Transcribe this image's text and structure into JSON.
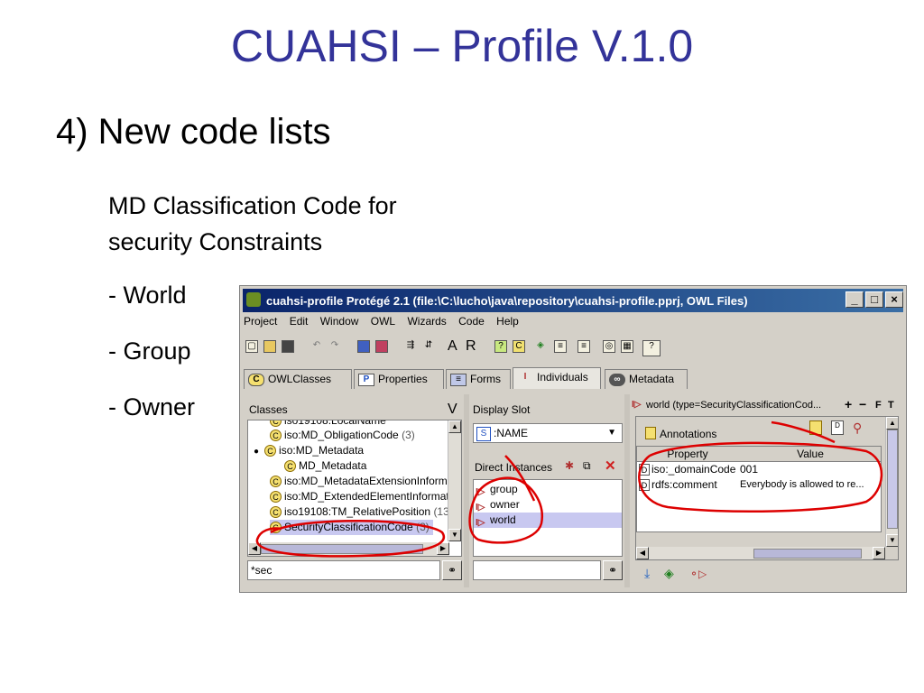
{
  "slide": {
    "title": "CUAHSI – Profile V.1.0",
    "subtitle": "4) New code lists",
    "description_line1": "MD Classification Code for",
    "description_line2": "security Constraints",
    "bullets": [
      "- World",
      "- Group",
      "- Owner"
    ]
  },
  "window": {
    "title": "cuahsi-profile  Protégé 2.1     (file:\\C:\\lucho\\java\\repository\\cuahsi-profile.pprj, OWL Files)",
    "controls": {
      "minimize": "_",
      "maximize": "□",
      "close": "×"
    },
    "menu": [
      "Project",
      "Edit",
      "Window",
      "OWL",
      "Wizards",
      "Code",
      "Help"
    ],
    "toolbar_text": [
      "A",
      "R"
    ],
    "tabs": [
      {
        "label": "OWLClasses",
        "icon": "C"
      },
      {
        "label": "Properties",
        "icon": "P"
      },
      {
        "label": "Forms",
        "icon": "≡"
      },
      {
        "label": "Individuals",
        "icon": "I"
      },
      {
        "label": "Metadata",
        "icon": "∞"
      }
    ],
    "selected_tab": "Individuals"
  },
  "classes_panel": {
    "header": "Classes",
    "header_right": "V",
    "items": [
      {
        "label": "iso19108:LocalName",
        "count": ""
      },
      {
        "label": "iso:MD_ObligationCode",
        "count": "(3)"
      },
      {
        "label": "iso:MD_Metadata",
        "count": ""
      },
      {
        "label": "MD_Metadata",
        "count": ""
      },
      {
        "label": "iso:MD_MetadataExtensionInformat",
        "count": ""
      },
      {
        "label": "iso:MD_ExtendedElementInformatic",
        "count": ""
      },
      {
        "label": "iso19108:TM_RelativePosition",
        "count": "(13)"
      },
      {
        "label": "SecurityClassificationCode",
        "count": "(3)"
      }
    ],
    "search_value": "*sec"
  },
  "instances_panel": {
    "display_slot_label": "Display Slot",
    "slot_value": ":NAME",
    "slot_icon": "S",
    "direct_instances_label": "Direct Instances",
    "items": [
      "group",
      "owner",
      "world"
    ],
    "selected": "world"
  },
  "detail_panel": {
    "header": "world   (type=SecurityClassificationCod...",
    "header_buttons": [
      "+",
      "−",
      "F",
      "T"
    ],
    "annotations_label": "Annotations",
    "columns": [
      "Property",
      "Value"
    ],
    "rows": [
      {
        "property": "iso:_domainCode",
        "value": "001"
      },
      {
        "property": "rdfs:comment",
        "value": "Everybody is allowed to re..."
      }
    ]
  },
  "colors": {
    "title_blue": "#333399",
    "annotation_red": "#dd0000",
    "selection": "#c8c8f0"
  }
}
